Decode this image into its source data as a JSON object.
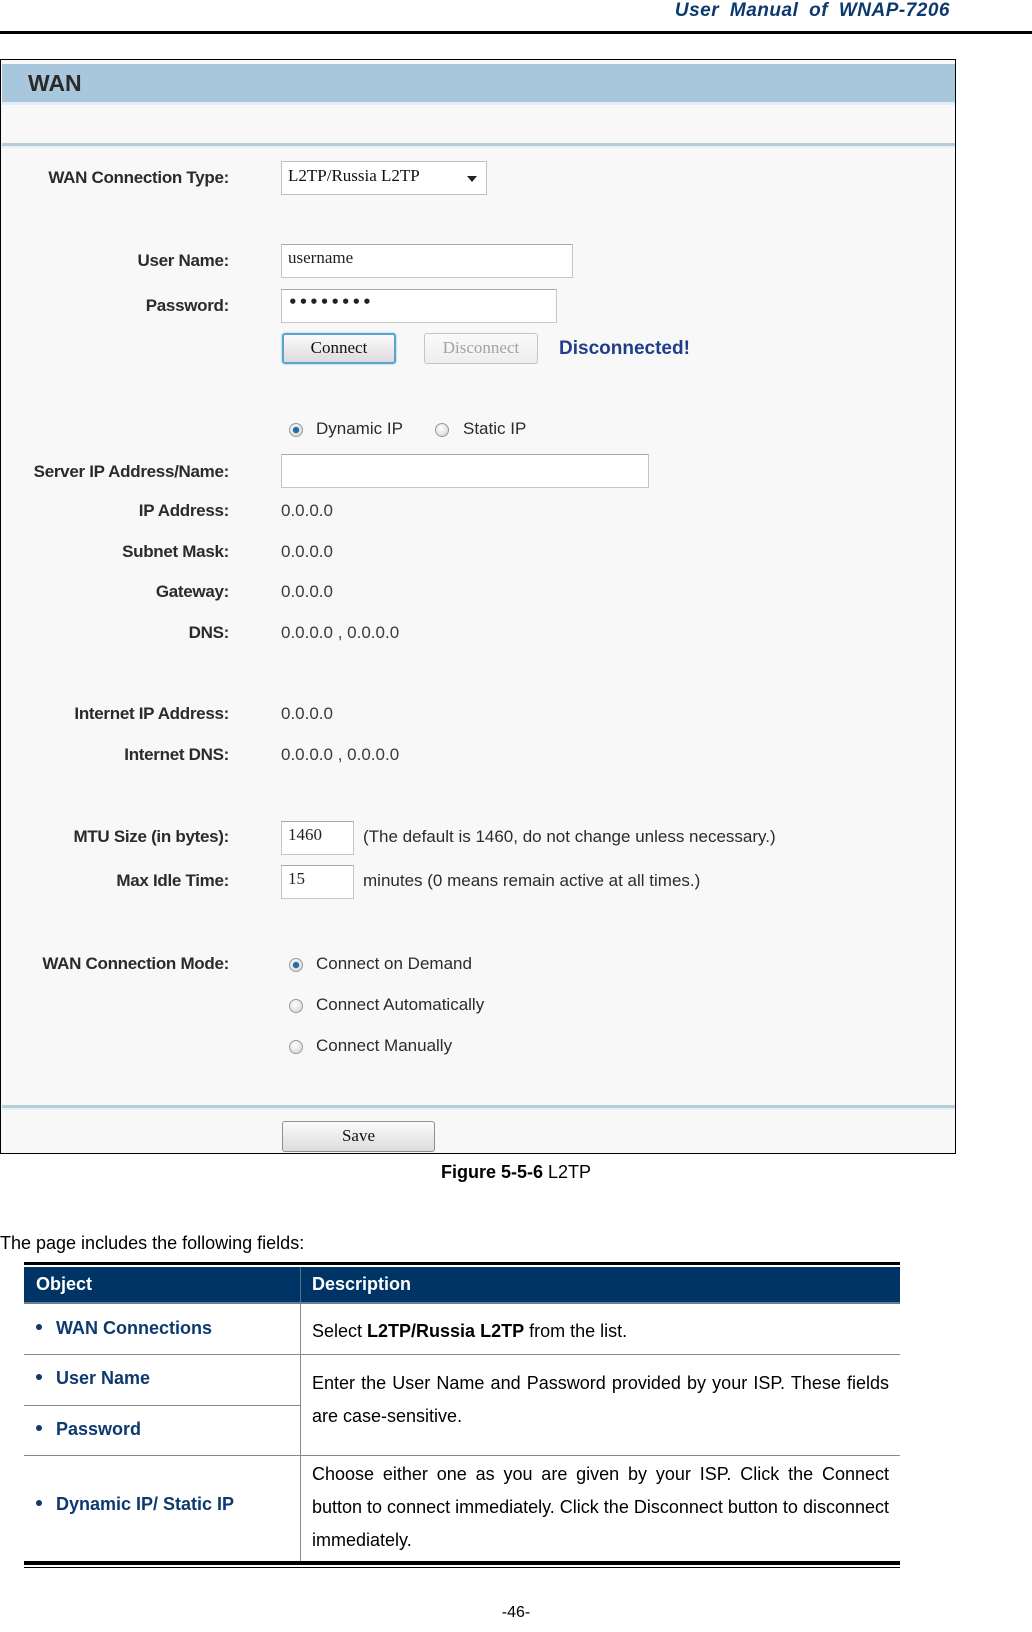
{
  "document": {
    "header_title": "User  Manual  of  WNAP-7206",
    "page_number": "-46-"
  },
  "figure": {
    "panel_title": "WAN",
    "wan_connection_type": {
      "label": "WAN Connection Type:",
      "selected": "L2TP/Russia L2TP"
    },
    "user_name": {
      "label": "User Name:",
      "value": "username"
    },
    "password": {
      "label": "Password:",
      "value": "••••••••"
    },
    "connect_label": "Connect",
    "disconnect_label": "Disconnect",
    "status_text": "Disconnected!",
    "ip_mode": {
      "options": [
        "Dynamic IP",
        "Static IP"
      ],
      "selected": "Dynamic IP"
    },
    "server_ip": {
      "label": "Server IP Address/Name:",
      "value": ""
    },
    "ip_address": {
      "label": "IP Address:",
      "value": "0.0.0.0"
    },
    "subnet_mask": {
      "label": "Subnet Mask:",
      "value": "0.0.0.0"
    },
    "gateway": {
      "label": "Gateway:",
      "value": "0.0.0.0"
    },
    "dns": {
      "label": "DNS:",
      "value": "0.0.0.0 , 0.0.0.0"
    },
    "internet_ip": {
      "label": "Internet IP Address:",
      "value": "0.0.0.0"
    },
    "internet_dns": {
      "label": "Internet DNS:",
      "value": "0.0.0.0 , 0.0.0.0"
    },
    "mtu": {
      "label": "MTU Size (in bytes):",
      "value": "1460",
      "hint": "(The default is 1460, do not change unless necessary.)"
    },
    "max_idle": {
      "label": "Max Idle Time:",
      "value": "15",
      "hint": "minutes (0 means remain active at all times.)"
    },
    "connection_mode": {
      "label": "WAN Connection Mode:",
      "options": [
        "Connect on Demand",
        "Connect Automatically",
        "Connect Manually"
      ],
      "selected": "Connect on Demand"
    },
    "save_label": "Save"
  },
  "caption": {
    "prefix": "Figure 5-5-6",
    "text": " L2TP"
  },
  "intro": "The page includes the following fields:",
  "table": {
    "headers": [
      "Object",
      "Description"
    ],
    "rows": [
      {
        "object": "WAN Connections",
        "desc_pre": "Select ",
        "desc_bold": "L2TP/Russia L2TP",
        "desc_post": " from the list."
      },
      {
        "object": "User Name"
      },
      {
        "object": "Password"
      },
      {
        "object": "Dynamic IP/ Static IP"
      }
    ],
    "merged_desc_user_pass": "Enter the User Name and Password provided by your ISP. These fields are case-sensitive.",
    "desc_dynamic_static": "Choose either one as you are given by your ISP. Click the Connect button to connect immediately. Click the Disconnect button to disconnect immediately."
  }
}
